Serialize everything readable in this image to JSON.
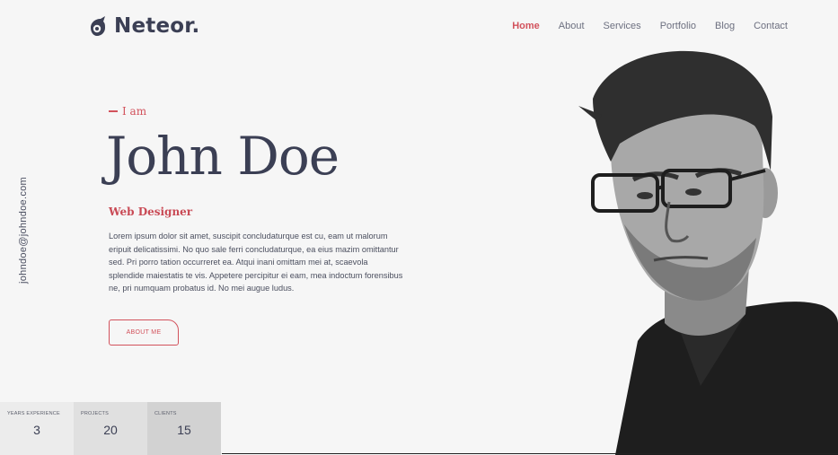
{
  "brand": {
    "name": "Neteor.",
    "accent": "#d2525c",
    "dark": "#3b3f54"
  },
  "nav": {
    "items": [
      {
        "label": "Home",
        "active": true
      },
      {
        "label": "About",
        "active": false
      },
      {
        "label": "Services",
        "active": false
      },
      {
        "label": "Portfolio",
        "active": false
      },
      {
        "label": "Blog",
        "active": false
      },
      {
        "label": "Contact",
        "active": false
      }
    ]
  },
  "side": {
    "email": "johndoe@johndoe.com"
  },
  "hero": {
    "intro": "I am",
    "name": "John Doe",
    "role": "Web Designer",
    "bio": "Lorem ipsum dolor sit amet, suscipit concludaturque est cu, eam ut malorum eripuit delicatissimi. No quo sale ferri concludaturque, ea eius mazim omittantur sed. Pri porro tation occurreret ea. Atqui inani omittam mei at, scaevola splendide maiestatis te vis. Appetere percipitur ei eam, mea indoctum forensibus ne, pri numquam probatus id. No mei augue ludus.",
    "button_label": "ABOUT ME"
  },
  "stats": [
    {
      "label": "YEARS EXPERIENCE",
      "value": "3"
    },
    {
      "label": "PROJECTS",
      "value": "20"
    },
    {
      "label": "CLIENTS",
      "value": "15"
    }
  ],
  "icons": {
    "logo": "comet-icon",
    "portrait": "portrait-image"
  }
}
